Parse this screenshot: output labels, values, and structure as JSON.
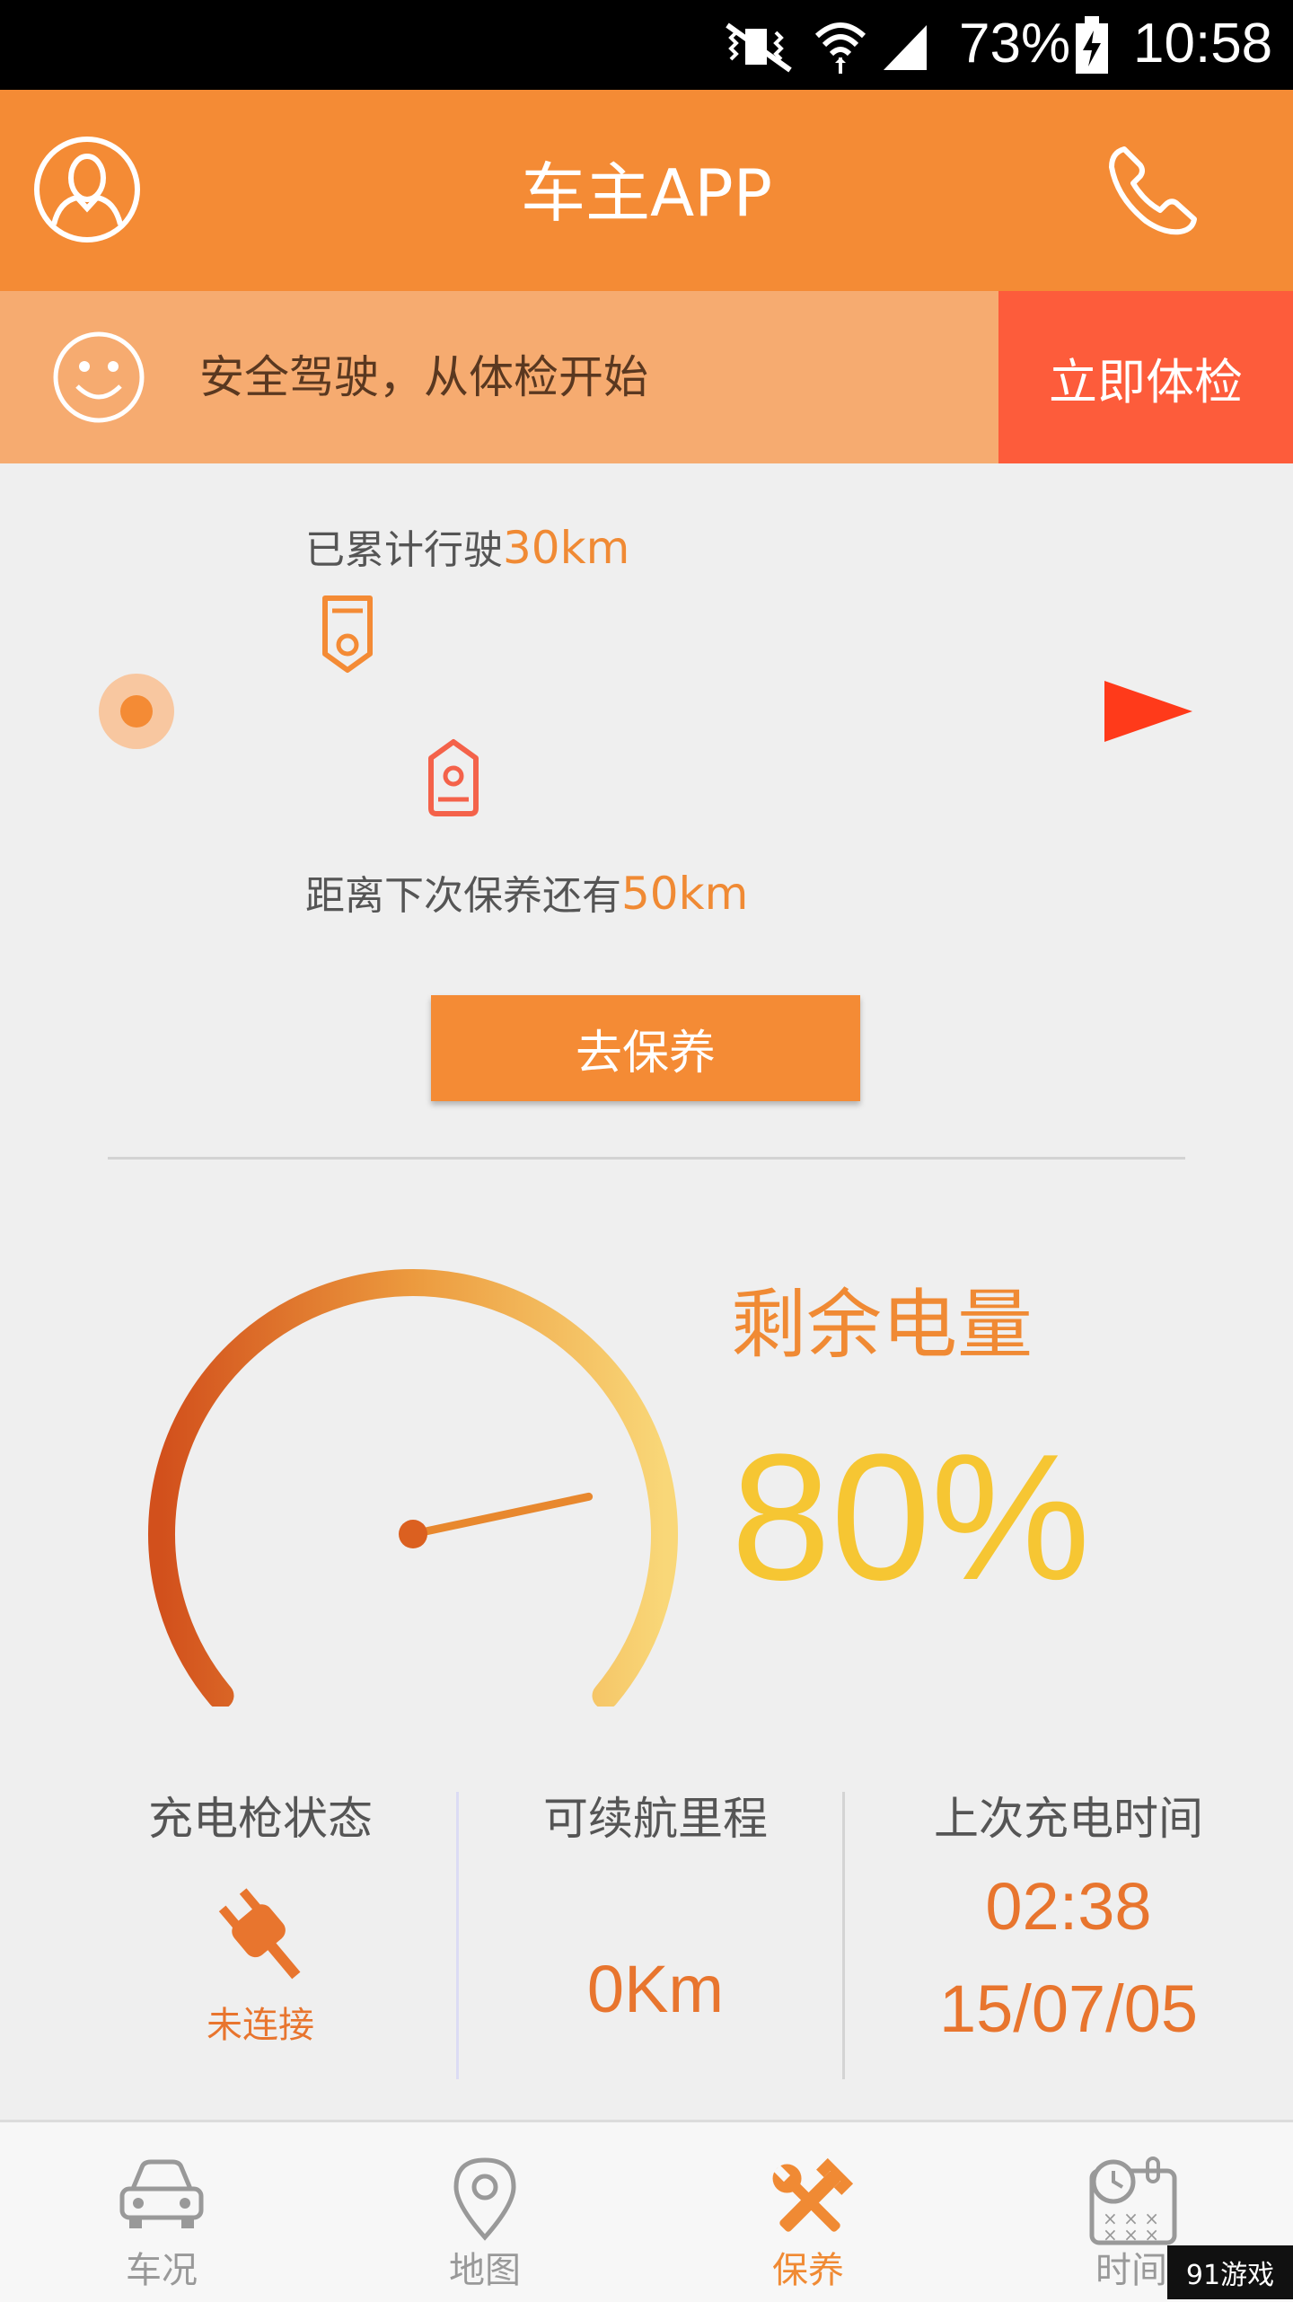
{
  "status_bar": {
    "battery": "73%",
    "time": "10:58"
  },
  "app_bar": {
    "title": "车主APP"
  },
  "banner": {
    "text": "安全驾驶，从体检开始",
    "button_label": "立即体检"
  },
  "mileage": {
    "driven_prefix": "已累计行驶",
    "driven_value": "30km",
    "next_prefix": "距离下次保养还有",
    "next_value": "50km",
    "button_label": "去保养"
  },
  "battery": {
    "title": "剩余电量",
    "value": "80%",
    "level_percent": 80
  },
  "stats": {
    "charger": {
      "label": "充电枪状态",
      "status": "未连接"
    },
    "range": {
      "label": "可续航里程",
      "value": "0Km"
    },
    "last_charge": {
      "label": "上次充电时间",
      "time": "02:38",
      "date": "15/07/05"
    }
  },
  "nav": {
    "items": [
      {
        "label": "车况",
        "icon": "car-icon"
      },
      {
        "label": "地图",
        "icon": "map-pin-icon"
      },
      {
        "label": "保养",
        "icon": "tools-icon"
      },
      {
        "label": "时间",
        "icon": "calendar-icon"
      }
    ],
    "active_index": 2
  },
  "watermark": "91游戏",
  "colors": {
    "primary": "#f48b35",
    "banner": "#f6ab70",
    "accent_button": "#fd5c3b",
    "battery_value": "#f6c633"
  }
}
